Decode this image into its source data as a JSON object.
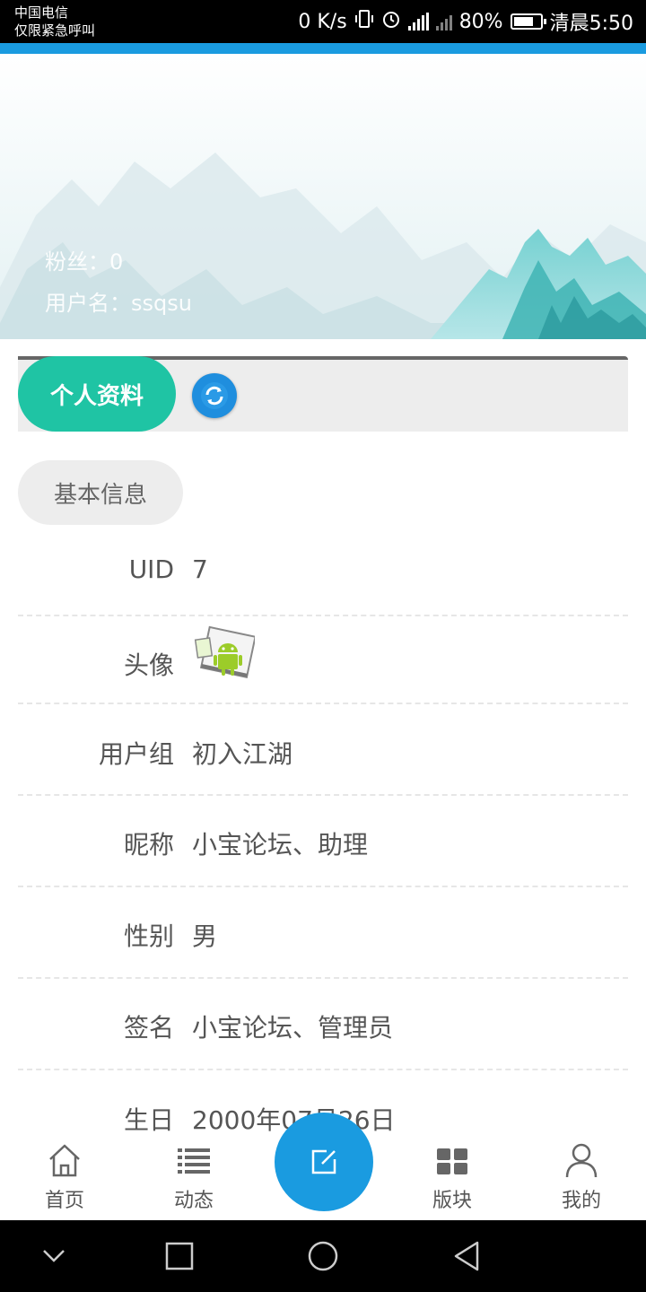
{
  "status_bar": {
    "carrier_line1": "中国电信",
    "carrier_line2": "仅限紧急呼叫",
    "net_speed": "0 K/s",
    "battery": "80%",
    "battery_level": 0.8,
    "time": "清晨5:50"
  },
  "profile": {
    "fans": "粉丝：0",
    "username": "用户名：ssqsu"
  },
  "tabs": {
    "active_label": "个人资料"
  },
  "section": {
    "title": "基本信息"
  },
  "fields": {
    "uid": {
      "label": "UID",
      "value": "7"
    },
    "avatar": {
      "label": "头像"
    },
    "group": {
      "label": "用户组",
      "value": "初入江湖"
    },
    "nickname": {
      "label": "昵称",
      "value": "小宝论坛、助理"
    },
    "gender": {
      "label": "性别",
      "value": "男"
    },
    "signature": {
      "label": "签名",
      "value": "小宝论坛、管理员"
    },
    "birthday": {
      "label": "生日",
      "value": "2000年07月26日"
    }
  },
  "bottom_nav": {
    "home": "首页",
    "feed": "动态",
    "boards": "版块",
    "mine": "我的"
  },
  "colors": {
    "accent_blue": "#1a9be0",
    "tab_green": "#1fc4a4",
    "status_bg": "#000000"
  },
  "icons": [
    "vibrate-icon",
    "alarm-icon",
    "signal-icon",
    "battery-icon",
    "refresh-icon",
    "android-avatar-icon",
    "home-icon",
    "list-icon",
    "edit-icon",
    "grid-icon",
    "user-icon",
    "back-icon",
    "home-circle-icon",
    "recent-icon",
    "hide-icon"
  ]
}
